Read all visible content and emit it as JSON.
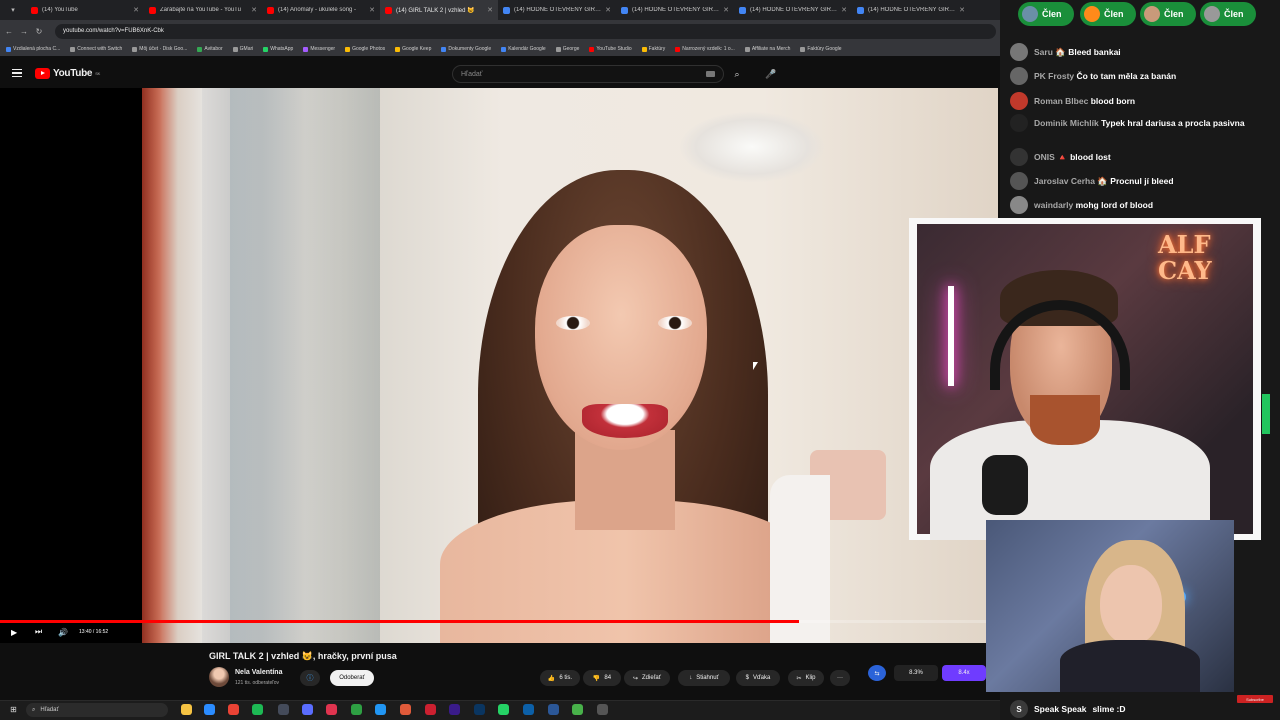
{
  "browser": {
    "tabs": [
      {
        "title": "(14) YouTube",
        "color": "#ff0000"
      },
      {
        "title": "Zarábajte na YouTube - YouTu",
        "color": "#ff0000"
      },
      {
        "title": "(14) Anomaly - ukulele song -",
        "color": "#ff0000"
      },
      {
        "title": "(14) GIRL TALK 2 | vzhled 😺",
        "color": "#ff0000",
        "active": true
      },
      {
        "title": "(14) HODNÉ OTEVŘENÝ GIRL T",
        "color": "#4285f4"
      },
      {
        "title": "(14) HODNÉ OTEVŘENÝ GIRL T",
        "color": "#4285f4"
      },
      {
        "title": "(14) HODNÉ OTEVŘENÝ GIRL T",
        "color": "#4285f4"
      },
      {
        "title": "(14) HODNÉ OTEVŘENÝ GIRL T",
        "color": "#4285f4"
      }
    ],
    "url": "youtube.com/watch?v=FUB6XnK-Cbk",
    "bookmarks": [
      {
        "label": "Vzdialená plocha C...",
        "color": "#4285f4"
      },
      {
        "label": "Connect with Switch",
        "color": "#999999"
      },
      {
        "label": "Môj účet · Disk Goo...",
        "color": "#999999"
      },
      {
        "label": "Avitabor",
        "color": "#34a853"
      },
      {
        "label": "GMari",
        "color": "#999999"
      },
      {
        "label": "WhatsApp",
        "color": "#25d366"
      },
      {
        "label": "Messenger",
        "color": "#a45cff"
      },
      {
        "label": "Google Photos",
        "color": "#fbbc05"
      },
      {
        "label": "Google Keep",
        "color": "#fbbc05"
      },
      {
        "label": "Dokumenty Google",
        "color": "#4285f4"
      },
      {
        "label": "Kalendár Google",
        "color": "#4285f4"
      },
      {
        "label": "George",
        "color": "#999999"
      },
      {
        "label": "YouTube Studio",
        "color": "#ff0000"
      },
      {
        "label": "Faktúry",
        "color": "#fbbc05"
      },
      {
        "label": "Narrozený vzdelk: 1 o...",
        "color": "#ff0000"
      },
      {
        "label": "Affiliate na Merch",
        "color": "#999999"
      },
      {
        "label": "Faktúry Google",
        "color": "#999999"
      }
    ]
  },
  "youtube": {
    "logo_text": "YouTube",
    "logo_region": "SK",
    "search_placeholder": "Hľadať",
    "player": {
      "time": "13:40 / 16:52",
      "progress_fraction": 0.81
    },
    "video_title": "GIRL TALK 2 | vzhled 😺, hračky, první pusa",
    "channel_name": "Nela Valentína",
    "channel_subs": "121 tis. odberateľov",
    "subscribe_label": "Odoberať",
    "like_count": "6 tis.",
    "dislike_count": "84",
    "share_label": "Zdieľať",
    "download_label": "Stiahnuť",
    "thanks_label": "Vďaka",
    "clip_label": "Klip",
    "ext_value1": "8.3%",
    "ext_value2": "8.4x"
  },
  "taskbar": {
    "search_label": "Hľadať",
    "icons": [
      {
        "name": "explorer-icon",
        "color": "#f6c343"
      },
      {
        "name": "vpn-icon",
        "color": "#2b8cff"
      },
      {
        "name": "chrome-icon",
        "color": "#ea4335"
      },
      {
        "name": "spotify-icon",
        "color": "#1db954"
      },
      {
        "name": "steam-icon",
        "color": "#444b5a"
      },
      {
        "name": "obs-icon",
        "color": "#5a6dff"
      },
      {
        "name": "ticktick-icon",
        "color": "#e0344f"
      },
      {
        "name": "xbox-icon",
        "color": "#2ea043"
      },
      {
        "name": "app-icon",
        "color": "#2196f3"
      },
      {
        "name": "davinci-icon",
        "color": "#e05a3a"
      },
      {
        "name": "record-icon",
        "color": "#cc2030"
      },
      {
        "name": "premiere-icon",
        "color": "#3a1b8a"
      },
      {
        "name": "photoshop-icon",
        "color": "#0a3560"
      },
      {
        "name": "whatsapp-icon",
        "color": "#25d366"
      },
      {
        "name": "ps-icon",
        "color": "#0c60a8"
      },
      {
        "name": "word-icon",
        "color": "#2b5797"
      },
      {
        "name": "store-icon",
        "color": "#48b14a"
      },
      {
        "name": "misc-icon",
        "color": "#555555"
      }
    ]
  },
  "stream": {
    "member_label": "Člen",
    "chat": [
      {
        "user": "Saru 🏠",
        "text": "Bleed bankai"
      },
      {
        "user": "PK Frosty",
        "text": "Čo to tam měla za banán"
      },
      {
        "user": "Roman Blbec",
        "text": "blood born"
      },
      {
        "user": "Dominik Michlík",
        "text": "Typek hral dariusa a procla pasivna"
      },
      {
        "user": "ONIS 🔺",
        "text": "blood lost"
      },
      {
        "user": "Jaroslav Cerha 🏠",
        "text": "Procnul jí bleed"
      },
      {
        "user": "waindarly",
        "text": "mohg lord of blood"
      }
    ],
    "last_message": {
      "user": "Speak Speak",
      "text": "slime :D"
    },
    "neon_sign": "ALF\nCAY",
    "subscribe_badge": "Subscribe"
  }
}
